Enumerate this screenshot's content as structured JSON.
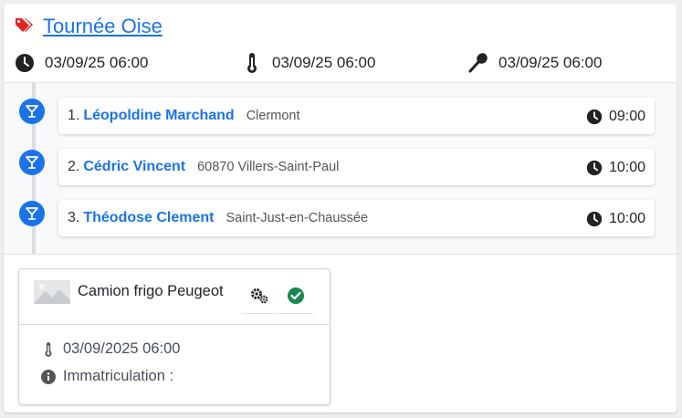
{
  "tour": {
    "title": "Tournée Oise",
    "icons": {
      "tag": "tags-icon"
    },
    "colors": {
      "tag": "#e02424",
      "link": "#1a73e8"
    }
  },
  "meta": [
    {
      "icon": "clock-icon",
      "value": "03/09/25 06:00"
    },
    {
      "icon": "thermometer-icon",
      "value": "03/09/25 06:00"
    },
    {
      "icon": "spoon-icon",
      "value": "03/09/25 06:00"
    }
  ],
  "stops": [
    {
      "index": "1.",
      "name": "Léopoldine Marchand",
      "city": "Clermont",
      "time": "09:00"
    },
    {
      "index": "2.",
      "name": "Cédric Vincent",
      "city": "60870 Villers-Saint-Paul",
      "time": "10:00"
    },
    {
      "index": "3.",
      "name": "Théodose Clement",
      "city": "Saint-Just-en-Chaussée",
      "time": "10:00"
    }
  ],
  "stop_icon": "cocktail-icon",
  "vehicle": {
    "name": "Camion frigo Peugeot",
    "date": "03/09/2025 06:00",
    "registration_label": "Immatriculation :",
    "icons": {
      "image": "image-placeholder-icon",
      "settings": "gears-icon",
      "status": "check-circle-icon",
      "date": "thermometer-icon",
      "info": "info-circle-icon"
    },
    "colors": {
      "status": "#198754"
    }
  }
}
